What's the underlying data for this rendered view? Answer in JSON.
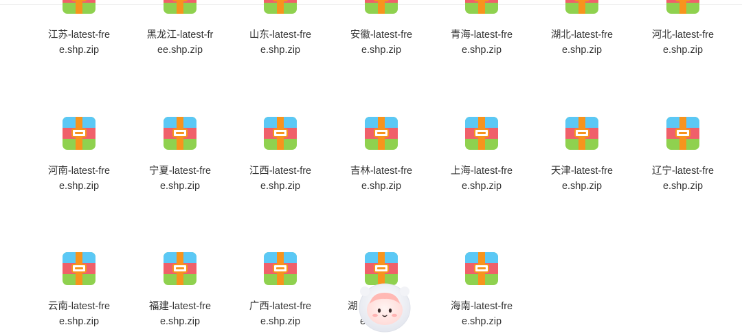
{
  "files": [
    {
      "line1": "江苏-latest-fre",
      "line2": "e.shp.zip"
    },
    {
      "line1": "黑龙江-latest-fr",
      "line2": "ee.shp.zip"
    },
    {
      "line1": "山东-latest-fre",
      "line2": "e.shp.zip"
    },
    {
      "line1": "安徽-latest-fre",
      "line2": "e.shp.zip"
    },
    {
      "line1": "青海-latest-fre",
      "line2": "e.shp.zip"
    },
    {
      "line1": "湖北-latest-fre",
      "line2": "e.shp.zip"
    },
    {
      "line1": "河北-latest-fre",
      "line2": "e.shp.zip"
    },
    {
      "line1": "河南-latest-fre",
      "line2": "e.shp.zip"
    },
    {
      "line1": "宁夏-latest-fre",
      "line2": "e.shp.zip"
    },
    {
      "line1": "江西-latest-fre",
      "line2": "e.shp.zip"
    },
    {
      "line1": "吉林-latest-fre",
      "line2": "e.shp.zip"
    },
    {
      "line1": "上海-latest-fre",
      "line2": "e.shp.zip"
    },
    {
      "line1": "天津-latest-fre",
      "line2": "e.shp.zip"
    },
    {
      "line1": "辽宁-latest-fre",
      "line2": "e.shp.zip"
    },
    {
      "line1": "云南-latest-fre",
      "line2": "e.shp.zip"
    },
    {
      "line1": "福建-latest-fre",
      "line2": "e.shp.zip"
    },
    {
      "line1": "广西-latest-fre",
      "line2": "e.shp.zip"
    },
    {
      "line1": "湖",
      "line2": "e.s"
    },
    {
      "line1": "海南-latest-fre",
      "line2": "e.shp.zip"
    }
  ],
  "icon": "archive-zip-icon",
  "colors": {
    "icon_top": "#5bc8f5",
    "icon_middle": "#f0606a",
    "icon_bottom": "#8fd14f",
    "icon_strap": "#f7941d",
    "text": "#333333"
  }
}
